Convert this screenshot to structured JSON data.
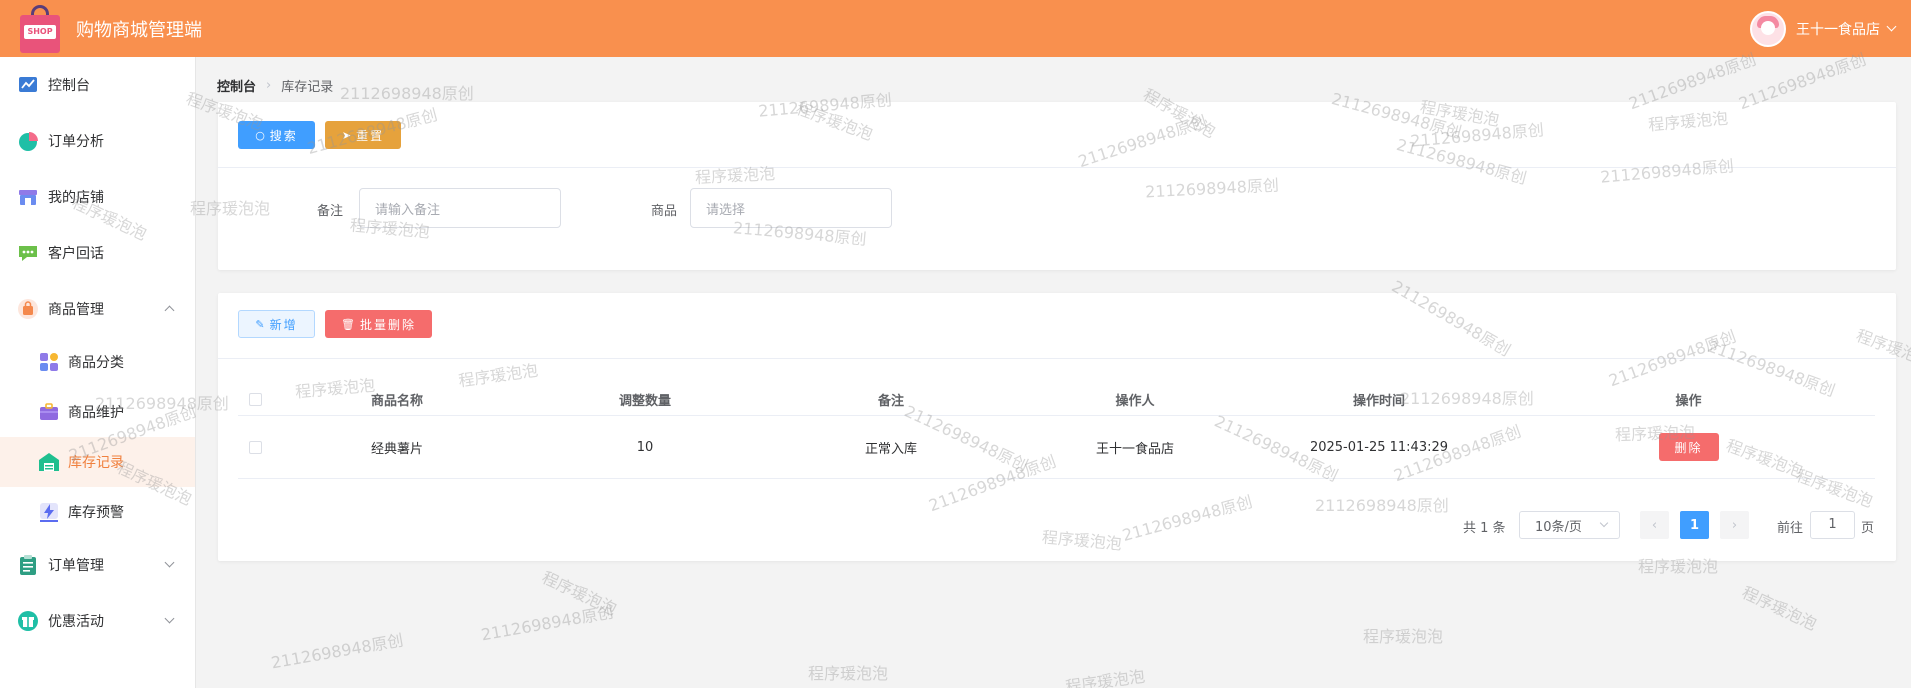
{
  "app": {
    "title": "购物商城管理端",
    "logo_text": "SHOP"
  },
  "user": {
    "name": "王十一食品店"
  },
  "sidebar": {
    "items": [
      {
        "label": "控制台",
        "icon": "chart-line-icon"
      },
      {
        "label": "订单分析",
        "icon": "pie-chart-icon"
      },
      {
        "label": "我的店铺",
        "icon": "store-icon"
      },
      {
        "label": "客户回话",
        "icon": "chat-bubble-icon"
      },
      {
        "label": "商品管理",
        "icon": "shopping-bag-icon",
        "expanded": true
      },
      {
        "label": "商品分类",
        "icon": "category-grid-icon"
      },
      {
        "label": "商品维护",
        "icon": "briefcase-icon"
      },
      {
        "label": "库存记录",
        "icon": "warehouse-icon",
        "active": true
      },
      {
        "label": "库存预警",
        "icon": "lightning-alert-icon"
      },
      {
        "label": "订单管理",
        "icon": "clipboard-icon"
      },
      {
        "label": "优惠活动",
        "icon": "gift-icon"
      }
    ]
  },
  "breadcrumb": {
    "home": "控制台",
    "current": "库存记录"
  },
  "search": {
    "search_label": "搜索",
    "reset_label": "重置",
    "remark_label": "备注",
    "remark_placeholder": "请输入备注",
    "product_label": "商品",
    "product_placeholder": "请选择"
  },
  "actions": {
    "add_label": "新增",
    "batch_delete_label": "批量删除"
  },
  "table": {
    "headers": [
      "商品名称",
      "调整数量",
      "备注",
      "操作人",
      "操作时间",
      "操作"
    ],
    "rows": [
      {
        "name": "经典薯片",
        "qty": "10",
        "remark": "正常入库",
        "operator": "王十一食品店",
        "time": "2025-01-25 11:43:29",
        "action": "删除"
      }
    ]
  },
  "pagination": {
    "total_text": "共 1 条",
    "page_size": "10条/页",
    "current_page": "1",
    "goto_label": "前往",
    "goto_value": "1",
    "page_unit": "页"
  },
  "watermarks": [
    "2112698948原创",
    "程序瑗泡泡"
  ],
  "colors": {
    "header": "#f9904e",
    "primary": "#409eff",
    "warning": "#e6a23c",
    "danger": "#f56c6c",
    "active": "#f0813f"
  }
}
